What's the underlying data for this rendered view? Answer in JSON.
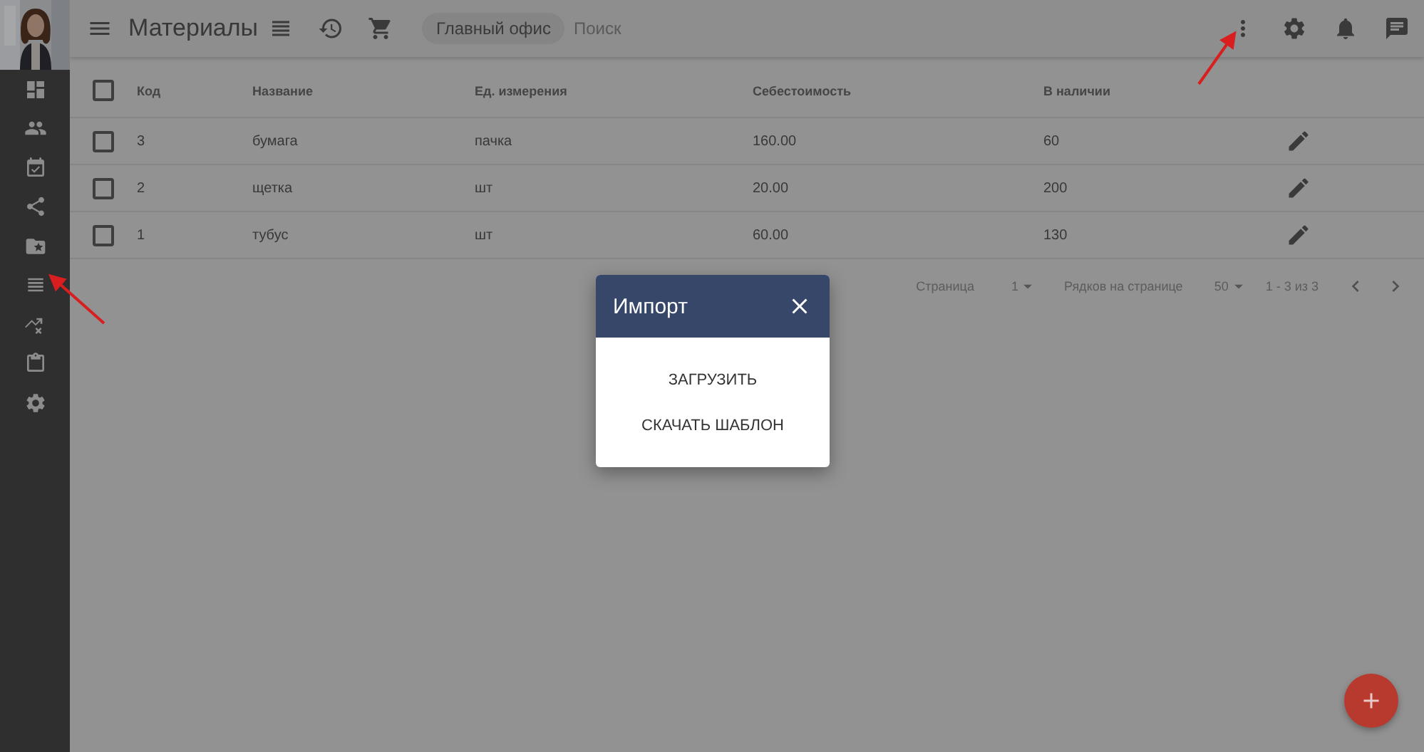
{
  "sidebar": {
    "items": [
      {
        "kind": "dashboard",
        "pointed_by_arrow": false
      },
      {
        "kind": "people",
        "pointed_by_arrow": false
      },
      {
        "kind": "calendar",
        "pointed_by_arrow": false
      },
      {
        "kind": "share",
        "pointed_by_arrow": false
      },
      {
        "kind": "folder",
        "pointed_by_arrow": false
      },
      {
        "kind": "list",
        "pointed_by_arrow": true
      },
      {
        "kind": "trend",
        "pointed_by_arrow": false
      },
      {
        "kind": "clipboard",
        "pointed_by_arrow": false
      },
      {
        "kind": "settings",
        "pointed_by_arrow": false
      }
    ]
  },
  "toolbar": {
    "title": "Материалы",
    "tools": [
      {
        "kind": "list"
      },
      {
        "kind": "history"
      },
      {
        "kind": "cart"
      }
    ],
    "office": "Главный офис",
    "search": {
      "placeholder": "Поиск"
    },
    "actions": [
      {
        "kind": "more",
        "pointed_by_arrow": true
      },
      {
        "kind": "settings",
        "pointed_by_arrow": false
      },
      {
        "kind": "bell",
        "pointed_by_arrow": false
      },
      {
        "kind": "chat",
        "pointed_by_arrow": false
      }
    ]
  },
  "table": {
    "header_checked": false,
    "columns": [
      "Код",
      "Название",
      "Ед. измерения",
      "Себестоимость",
      "В наличии"
    ],
    "rows": [
      {
        "checked": false,
        "cells": [
          "3",
          "бумага",
          "пачка",
          "160.00",
          "60"
        ]
      },
      {
        "checked": false,
        "cells": [
          "2",
          "щетка",
          "шт",
          "20.00",
          "200"
        ]
      },
      {
        "checked": false,
        "cells": [
          "1",
          "тубус",
          "шт",
          "60.00",
          "130"
        ]
      }
    ]
  },
  "pagination": {
    "page_label": "Страница",
    "page": "1",
    "rows_label": "Рядков на странице",
    "rows_per_page": "50",
    "range": "1 - 3 из 3"
  },
  "dialog": {
    "title": "Импорт",
    "actions": [
      "ЗАГРУЗИТЬ",
      "СКАЧАТЬ ШАБЛОН"
    ]
  }
}
